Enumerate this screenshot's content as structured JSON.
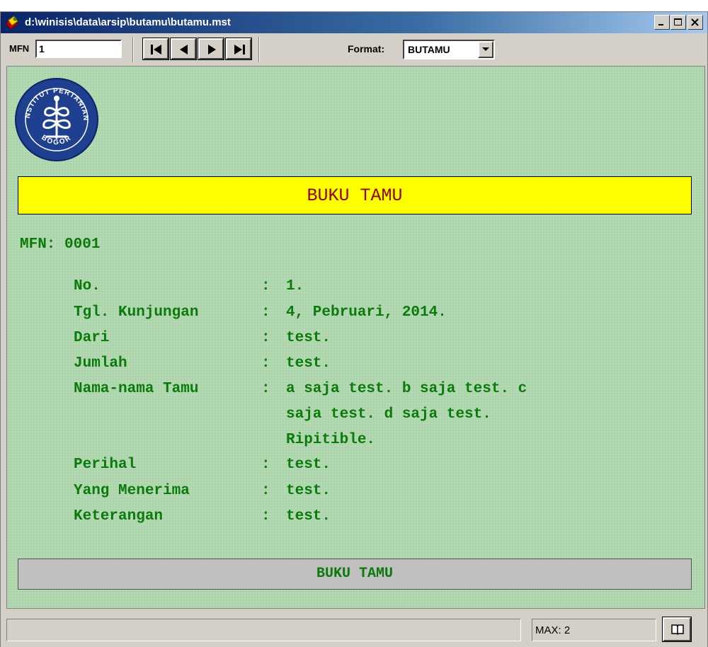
{
  "window": {
    "title": "d:\\winisis\\data\\arsip\\butamu\\butamu.mst"
  },
  "toolbar": {
    "mfn_label": "MFN",
    "mfn_value": "1",
    "format_label": "Format:",
    "format_value": "BUTAMU"
  },
  "logo": {
    "text_top": "INSTITUT PERTANIAN",
    "text_bottom": "BOGOR"
  },
  "record": {
    "header": "BUKU TAMU",
    "mfn_line": "MFN: 0001",
    "fields": [
      {
        "label": "No.",
        "sep": ":",
        "value": "1."
      },
      {
        "label": "Tgl. Kunjungan",
        "sep": ":",
        "value": "4, Pebruari, 2014."
      },
      {
        "label": "Dari",
        "sep": ":",
        "value": "test."
      },
      {
        "label": "Jumlah",
        "sep": ":",
        "value": "test."
      },
      {
        "label": "Nama-nama Tamu",
        "sep": ":",
        "value": "a saja test. b saja test. c\nsaja test. d saja test.\nRipitible."
      },
      {
        "label": "Perihal",
        "sep": ":",
        "value": "test."
      },
      {
        "label": "Yang Menerima",
        "sep": ":",
        "value": "test."
      },
      {
        "label": "Keterangan",
        "sep": ":",
        "value": "test."
      }
    ],
    "footer": "BUKU TAMU"
  },
  "statusbar": {
    "status_text": "",
    "max_text": "MAX: 2"
  },
  "colors": {
    "content_bg": "#b3d9b3",
    "field_text": "#0a7a0a",
    "banner_bg": "#ffff00",
    "banner_text": "#990000"
  }
}
